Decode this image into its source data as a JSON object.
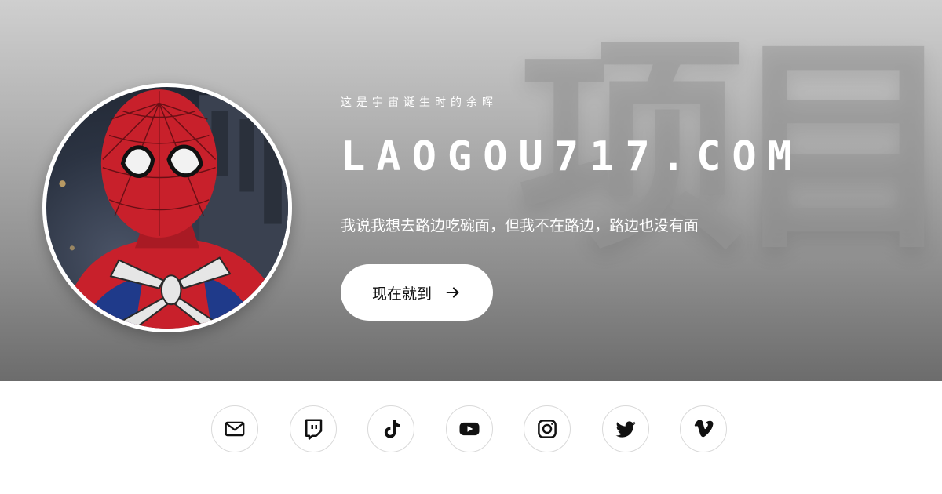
{
  "hero": {
    "background_glyphs": [
      "项",
      "目"
    ],
    "tagline": "这是宇宙诞生时的余晖",
    "title": "LAOGOU717.COM",
    "subtitle": "我说我想去路边吃碗面，但我不在路边，路边也没有面",
    "cta_label": "现在就到",
    "avatar_icon": "spiderman-avatar"
  },
  "social": {
    "icons": [
      "mail-icon",
      "twitch-icon",
      "tiktok-icon",
      "youtube-icon",
      "instagram-icon",
      "twitter-icon",
      "vimeo-icon"
    ]
  },
  "colors": {
    "hero_top": "#cfcfcf",
    "hero_bottom": "#6c6c6c",
    "spidey_red": "#c8202b",
    "spidey_blue": "#1f3a8a",
    "text_light": "#ffffff",
    "icon_dark": "#111111"
  }
}
